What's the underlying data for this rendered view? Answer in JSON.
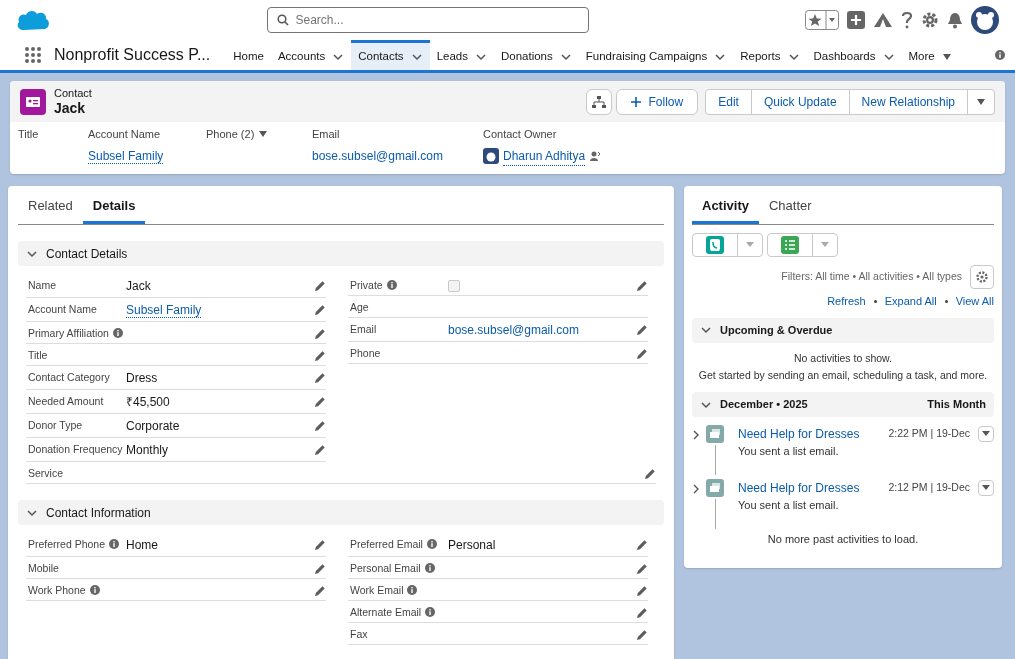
{
  "app_name": "Nonprofit Success P...",
  "search": {
    "placeholder": "Search..."
  },
  "nav": [
    {
      "label": "Home",
      "selected": false,
      "kind": "link"
    },
    {
      "label": "Accounts",
      "selected": false,
      "kind": "menu"
    },
    {
      "label": "Contacts",
      "selected": true,
      "kind": "menu"
    },
    {
      "label": "Leads",
      "selected": false,
      "kind": "menu"
    },
    {
      "label": "Donations",
      "selected": false,
      "kind": "menu"
    },
    {
      "label": "Fundraising Campaigns",
      "selected": false,
      "kind": "menu"
    },
    {
      "label": "Reports",
      "selected": false,
      "kind": "menu"
    },
    {
      "label": "Dashboards",
      "selected": false,
      "kind": "menu"
    },
    {
      "label": "More",
      "selected": false,
      "kind": "more"
    }
  ],
  "record": {
    "type": "Contact",
    "name": "Jack"
  },
  "actions": [
    {
      "label": "Follow",
      "kind": "plus"
    },
    {
      "label": "Edit",
      "kind": "plain"
    },
    {
      "label": "Quick Update",
      "kind": "plain"
    },
    {
      "label": "New Relationship",
      "kind": "plain"
    }
  ],
  "highlights": [
    {
      "label": "Title"
    },
    {
      "label": "Account Name",
      "value": "Subsel Family",
      "kind": "link"
    },
    {
      "label": "Phone (2)",
      "kind": "menu"
    },
    {
      "label": "Email",
      "value": "bose.subsel@gmail.com",
      "kind": "email"
    },
    {
      "label": "Contact Owner",
      "value": "Dharun Adhitya",
      "kind": "owner"
    }
  ],
  "detail_tabs": [
    {
      "label": "Related",
      "selected": false
    },
    {
      "label": "Details",
      "selected": true
    }
  ],
  "sections": [
    {
      "title": "Contact Details",
      "expanded": true,
      "left": [
        {
          "label": "Name",
          "value": "Jack",
          "kind": "text",
          "info": false,
          "editable": true
        },
        {
          "label": "Account Name",
          "value": "Subsel Family",
          "kind": "link",
          "info": false,
          "editable": true
        },
        {
          "label": "Primary Affiliation",
          "info": true,
          "editable": true
        },
        {
          "label": "Title",
          "info": false,
          "editable": true
        },
        {
          "label": "Contact Category",
          "value": "Dress",
          "kind": "text",
          "info": false,
          "editable": true
        },
        {
          "label": "Needed Amount",
          "value": "₹45,500",
          "kind": "text",
          "info": false,
          "editable": true
        },
        {
          "label": "Donor Type",
          "value": "Corporate",
          "kind": "text",
          "info": false,
          "editable": true
        },
        {
          "label": "Donation Frequency",
          "value": "Monthly",
          "kind": "text",
          "info": false,
          "editable": true
        }
      ],
      "right": [
        {
          "label": "Private",
          "kind": "checkbox",
          "checked": false,
          "info": true,
          "editable": true
        },
        {
          "label": "Age",
          "info": false,
          "editable": false
        },
        {
          "label": "Email",
          "value": "bose.subsel@gmail.com",
          "kind": "email",
          "info": false,
          "editable": true
        },
        {
          "label": "Phone",
          "info": false,
          "editable": true
        }
      ],
      "full": [
        {
          "label": "Service",
          "info": false,
          "editable": true
        }
      ]
    },
    {
      "title": "Contact Information",
      "expanded": true,
      "left": [
        {
          "label": "Preferred Phone",
          "value": "Home",
          "kind": "text",
          "info": true,
          "editable": true
        },
        {
          "label": "Mobile",
          "info": false,
          "editable": true
        },
        {
          "label": "Work Phone",
          "info": true,
          "editable": true
        }
      ],
      "right": [
        {
          "label": "Preferred Email",
          "value": "Personal",
          "kind": "text",
          "info": true,
          "editable": true
        },
        {
          "label": "Personal Email",
          "info": true,
          "editable": true
        },
        {
          "label": "Work Email",
          "info": true,
          "editable": true
        },
        {
          "label": "Alternate Email",
          "info": true,
          "editable": true
        },
        {
          "label": "Fax",
          "info": false,
          "editable": true
        }
      ]
    }
  ],
  "activity": {
    "tabs": [
      {
        "label": "Activity",
        "selected": true
      },
      {
        "label": "Chatter",
        "selected": false
      }
    ],
    "filters": "Filters: All time • All activities • All types",
    "links": [
      "Refresh",
      "Expand All",
      "View All"
    ],
    "groups": [
      {
        "title": "Upcoming & Overdue",
        "expanded": true,
        "empty": [
          "No activities to show.",
          "Get started by sending an email, scheduling a task, and more."
        ]
      },
      {
        "title": "December • 2025",
        "period": "This Month",
        "expanded": true,
        "items": [
          {
            "subject": "Need Help for Dresses",
            "time": "2:22 PM | 19-Dec",
            "summary": "You sent a list email.",
            "expanded": false
          },
          {
            "subject": "Need Help for Dresses",
            "time": "2:12 PM | 19-Dec",
            "summary": "You sent a list email.",
            "expanded": false
          }
        ]
      }
    ],
    "footer": "No more past activities to load."
  }
}
